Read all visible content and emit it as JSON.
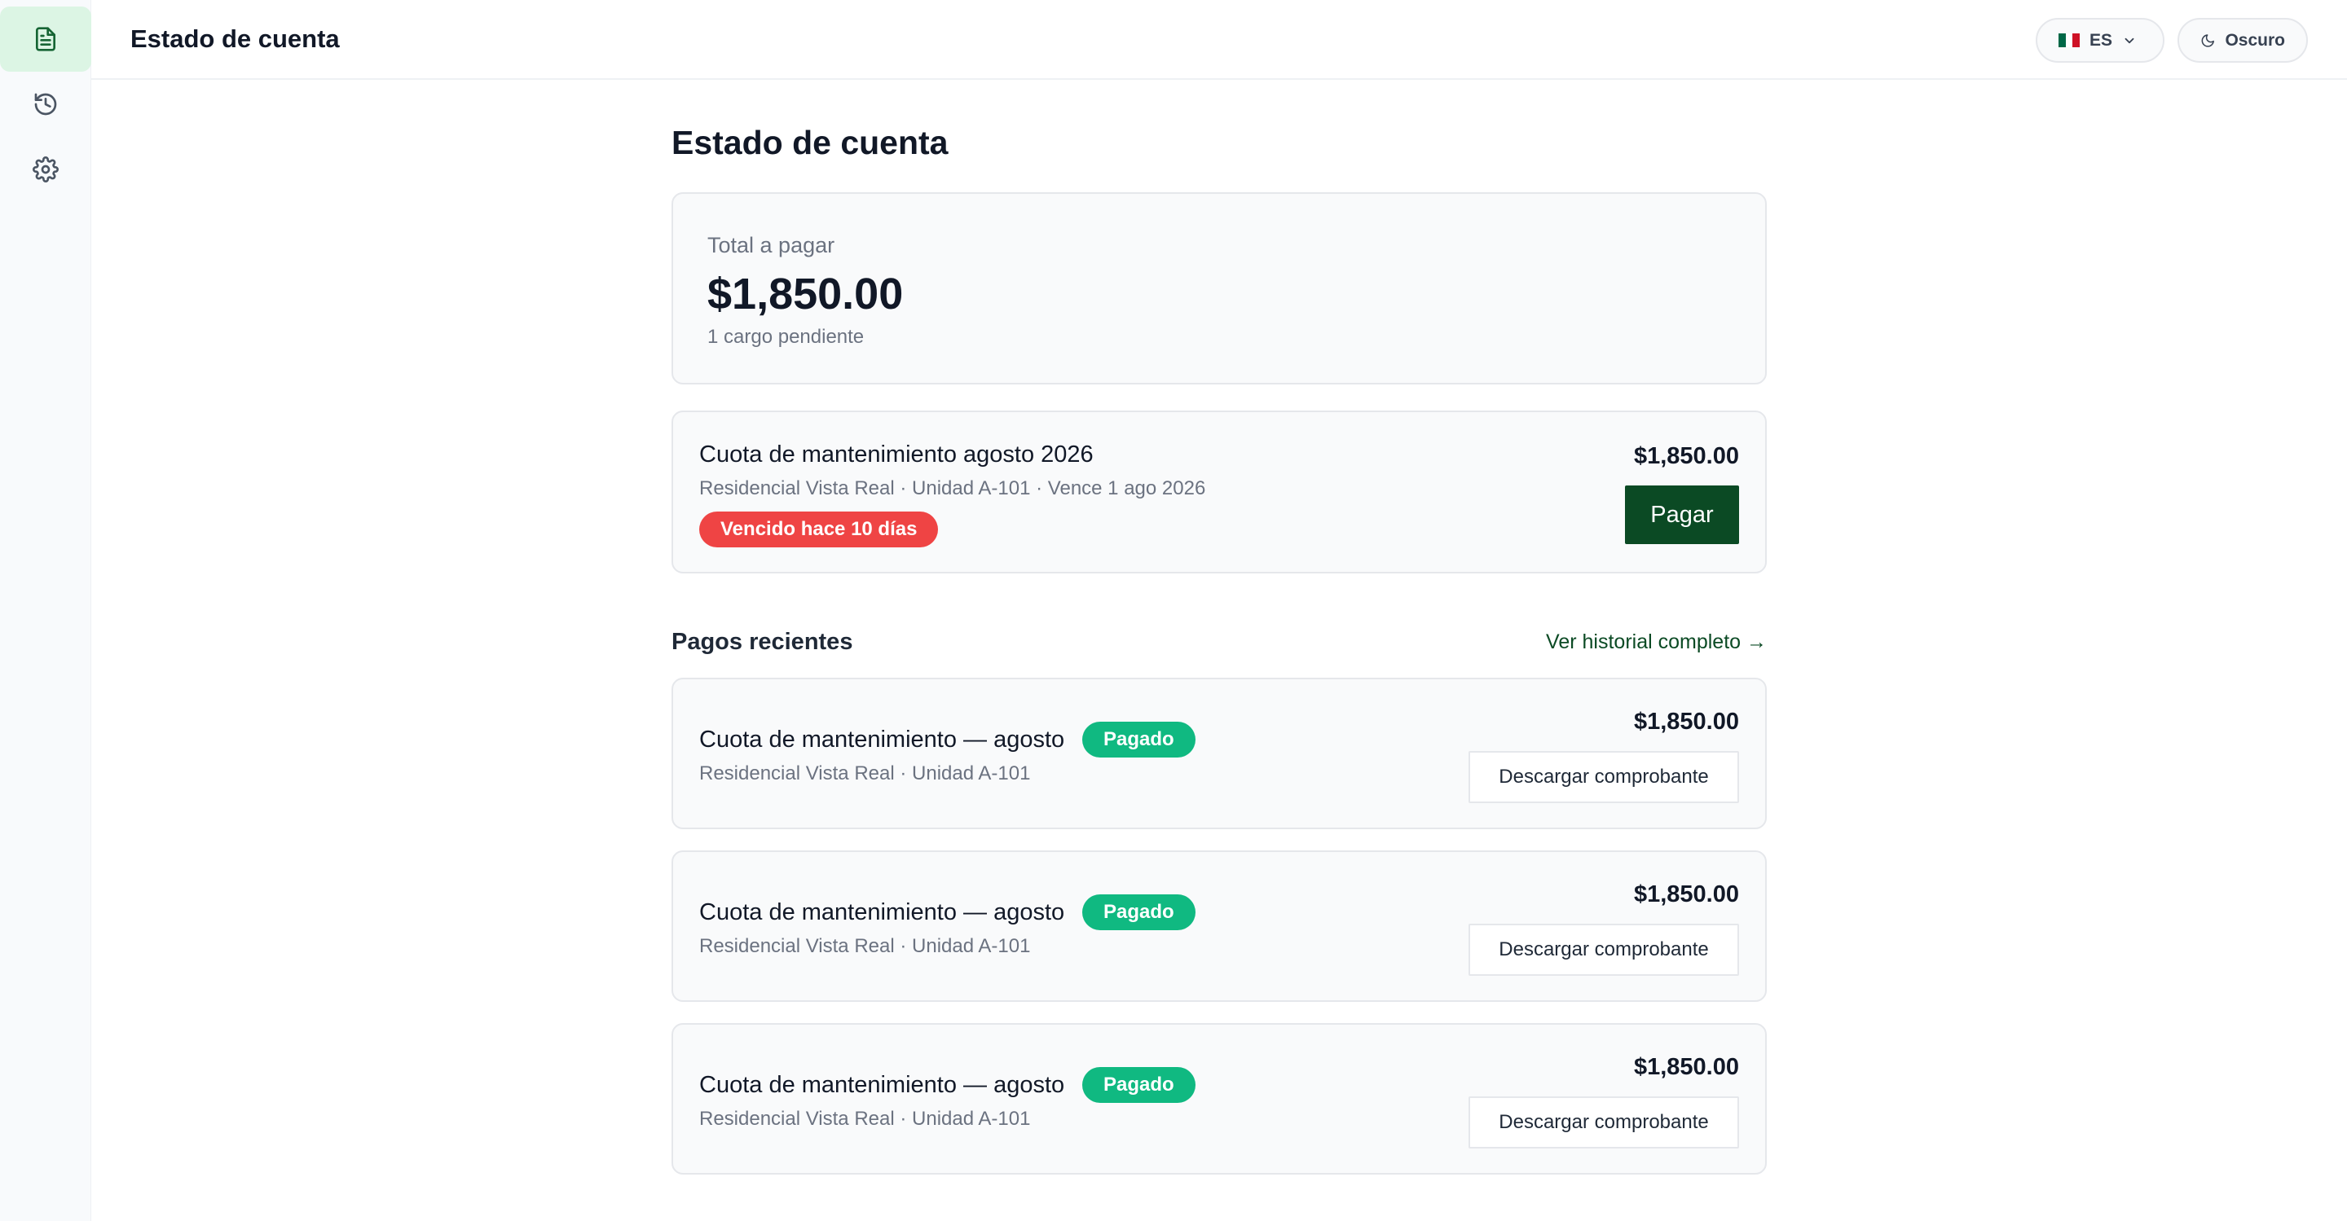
{
  "sidebar": {
    "items": [
      {
        "icon": "document-icon",
        "active": true
      },
      {
        "icon": "history-icon",
        "active": false
      },
      {
        "icon": "gear-icon",
        "active": false
      }
    ]
  },
  "header": {
    "title": "Estado de cuenta",
    "language": {
      "code": "ES",
      "flag": "mexico-flag-icon"
    },
    "theme_label": "Oscuro"
  },
  "main": {
    "page_title": "Estado de cuenta",
    "total": {
      "label": "Total a pagar",
      "amount": "$1,850.00",
      "pending": "1 cargo pendiente"
    },
    "due_item": {
      "title": "Cuota de mantenimiento agosto 2026",
      "subtitle": "Residencial Vista Real · Unidad A-101 · Vence 1 ago 2026",
      "badge": "Vencido hace 10 días",
      "amount": "$1,850.00",
      "pay_label": "Pagar"
    },
    "recent": {
      "title": "Pagos recientes",
      "link": "Ver historial completo →",
      "payments": [
        {
          "title": "Cuota de mantenimiento — agosto",
          "badge": "Pagado",
          "subtitle": "Residencial Vista Real · Unidad A-101",
          "amount": "$1,850.00",
          "download_label": "Descargar comprobante"
        },
        {
          "title": "Cuota de mantenimiento — agosto",
          "badge": "Pagado",
          "subtitle": "Residencial Vista Real · Unidad A-101",
          "amount": "$1,850.00",
          "download_label": "Descargar comprobante"
        },
        {
          "title": "Cuota de mantenimiento — agosto",
          "badge": "Pagado",
          "subtitle": "Residencial Vista Real · Unidad A-101",
          "amount": "$1,850.00",
          "download_label": "Descargar comprobante"
        }
      ]
    }
  },
  "colors": {
    "accent": "#0b4a24",
    "active_nav": "#dcf5e4",
    "overdue": "#ef4444",
    "paid": "#10b981"
  }
}
